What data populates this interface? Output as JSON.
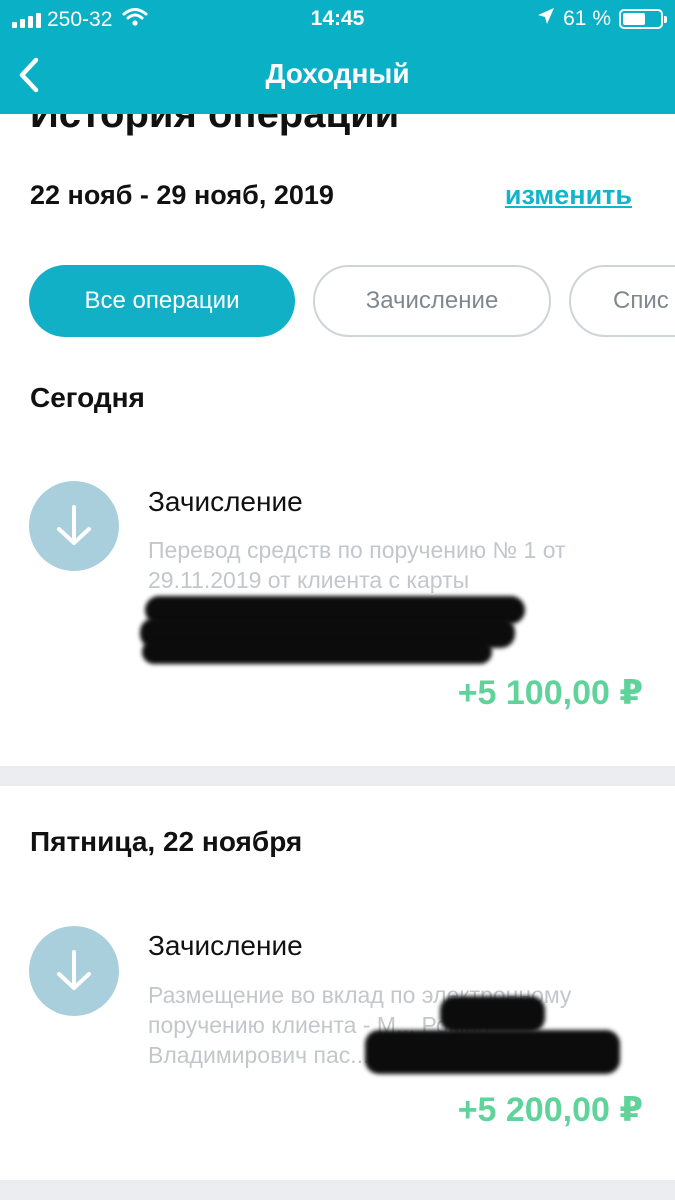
{
  "status_bar": {
    "carrier": "250-32",
    "time": "14:45",
    "battery": "61 %",
    "battery_level": 0.61,
    "icons": [
      "signal-icon",
      "wifi-icon",
      "location-icon",
      "battery-icon"
    ]
  },
  "nav": {
    "title": "Доходный",
    "back_icon": "chevron-left-icon"
  },
  "page_title": "История операций",
  "period": {
    "range": "22 нояб - 29 нояб, 2019",
    "change_label": "изменить"
  },
  "filters": [
    {
      "label": "Все операции",
      "active": true
    },
    {
      "label": "Зачисление",
      "active": false
    },
    {
      "label": "Спис",
      "active": false
    }
  ],
  "groups": [
    {
      "title": "Сегодня",
      "operations": [
        {
          "type": "Зачисление",
          "description": "Перевод средств по поручению № 1 от 29.11.2019 от клиента с карты",
          "amount": "+5 100,00 ₽",
          "icon": "arrow-down-icon"
        }
      ]
    },
    {
      "title": "Пятница, 22 ноября",
      "operations": [
        {
          "type": "Зачисление",
          "description": "Размещение во вклад по электронному поручению клиента - М... Роман Владимирович пас... 08",
          "amount": "+5 200,00 ₽",
          "icon": "arrow-down-icon"
        }
      ]
    }
  ],
  "colors": {
    "header": "#0ab1c6",
    "accent": "#12b5cc",
    "amount_positive": "#5fd39a",
    "icon_circle": "#a9cfdc",
    "separator": "#ecedf1"
  }
}
